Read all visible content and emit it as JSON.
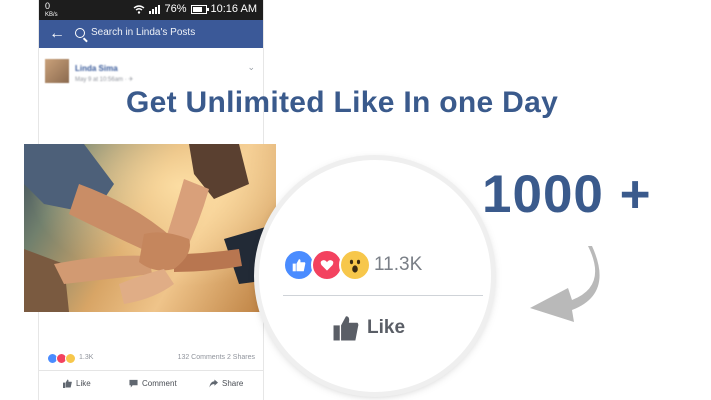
{
  "phone": {
    "status": {
      "left_top": "0",
      "left_bottom": "KB/s",
      "battery_percent": "76%",
      "time": "10:16 AM"
    },
    "search_placeholder": "Search in Linda's Posts",
    "post": {
      "author": "Linda Sima",
      "meta": "May 9 at 10:56am · ✈"
    },
    "reactions_count": "1.3K",
    "comments_shares": "132 Comments 2 Shares",
    "actions": {
      "like": "Like",
      "comment": "Comment",
      "share": "Share"
    }
  },
  "headline": "Get Unlimited Like In one Day",
  "count_big": "1000 +",
  "magnifier": {
    "reactions_count": "11.3K",
    "like_label": "Like"
  },
  "colors": {
    "brand_blue": "#3b5998",
    "headline_blue": "#3a5a8c",
    "like_blue": "#4a8cff",
    "love_red": "#f3425f",
    "wow_yellow": "#f7c74b"
  },
  "icons": [
    "back-arrow-icon",
    "search-icon",
    "wifi-icon",
    "signal-icon",
    "battery-icon",
    "like-thumb-icon",
    "comment-icon",
    "share-icon",
    "heart-icon",
    "wow-face-icon",
    "curved-arrow-icon"
  ]
}
